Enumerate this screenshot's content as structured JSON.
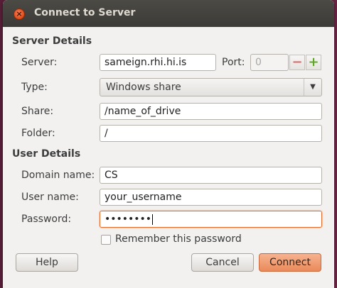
{
  "window": {
    "title": "Connect to Server",
    "close_glyph": "×"
  },
  "server_details": {
    "heading": "Server Details",
    "server_label": "Server:",
    "server_value": "sameign.rhi.hi.is",
    "port_label": "Port:",
    "port_value": "0",
    "port_decrement_glyph": "−",
    "port_increment_glyph": "+",
    "type_label": "Type:",
    "type_value": "Windows share",
    "type_arrow_glyph": "▼",
    "share_label": "Share:",
    "share_value": "/name_of_drive",
    "folder_label": "Folder:",
    "folder_value": "/"
  },
  "user_details": {
    "heading": "User Details",
    "domain_label": "Domain name:",
    "domain_value": "CS",
    "username_label": "User name:",
    "username_value": "your_username",
    "password_label": "Password:",
    "password_value": "••••••••",
    "remember_label": "Remember this password",
    "remember_checked": false
  },
  "buttons": {
    "help": "Help",
    "cancel": "Cancel",
    "connect": "Connect"
  },
  "colors": {
    "accent": "#ea8a5b",
    "focus_border": "#e46a2c",
    "titlebar": "#3c3b37",
    "plus_icon": "#5ea824",
    "minus_icon": "#d96b6b"
  }
}
